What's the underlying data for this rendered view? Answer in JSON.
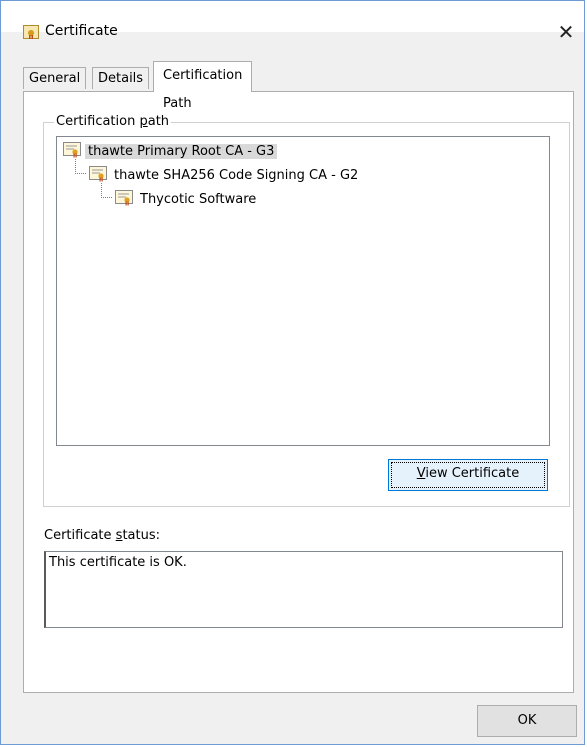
{
  "window": {
    "title": "Certificate",
    "icon": "certificate-icon",
    "close_glyph": "✕"
  },
  "tabs": [
    {
      "label": "General",
      "active": false
    },
    {
      "label": "Details",
      "active": false
    },
    {
      "label": "Certification Path",
      "active": true
    }
  ],
  "path_group": {
    "label_prefix": "Certification ",
    "label_accel": "p",
    "label_suffix": "ath",
    "nodes": [
      {
        "label": "thawte Primary Root CA - G3",
        "selected": true
      },
      {
        "label": "thawte SHA256 Code Signing CA - G2",
        "selected": false
      },
      {
        "label": "Thycotic Software",
        "selected": false
      }
    ],
    "view_button": {
      "accel": "V",
      "rest": "iew Certificate"
    }
  },
  "status": {
    "label_prefix": "Certificate ",
    "label_accel": "s",
    "label_suffix": "tatus:",
    "text": "This certificate is OK."
  },
  "ok_button": "OK",
  "colors": {
    "accent": "#0078d7",
    "selection": "#d9d9d9",
    "window_bg": "#f0f0f0",
    "border": "#6d9bd1"
  }
}
